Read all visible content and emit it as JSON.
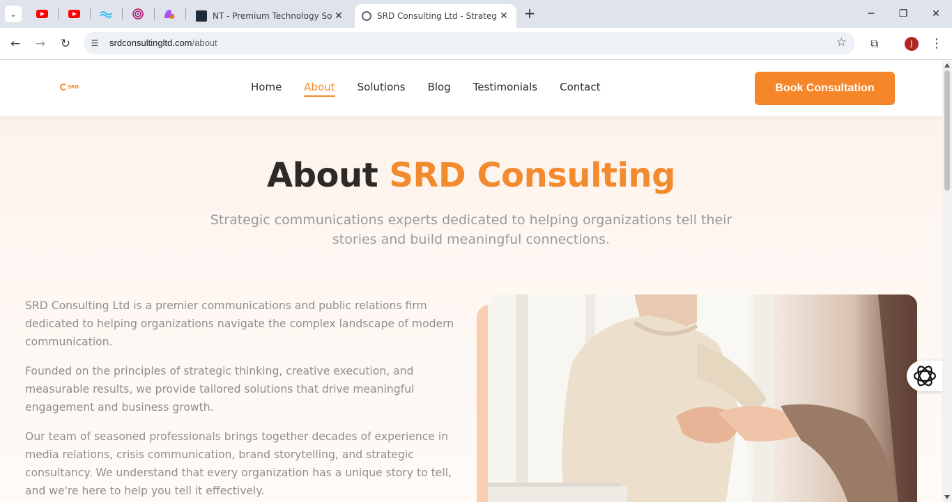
{
  "browser": {
    "tabs": [
      {
        "title": "NT - Premium Technology Solut",
        "active": false
      },
      {
        "title": "SRD Consulting Ltd - Strategic C",
        "active": true
      }
    ],
    "url_domain": "srdconsultingltd.com",
    "url_path": "/about",
    "profile_initial": "J"
  },
  "site": {
    "logo_text": "SRD",
    "nav": [
      "Home",
      "About",
      "Solutions",
      "Blog",
      "Testimonials",
      "Contact"
    ],
    "active_nav": "About",
    "cta_label": "Book Consultation",
    "accent_color": "#f28a2e"
  },
  "hero": {
    "title_plain": "About ",
    "title_accent": "SRD Consulting",
    "subtitle": "Strategic communications experts dedicated to helping organizations tell their stories and build meaningful connections."
  },
  "content": {
    "paragraphs": [
      "SRD Consulting Ltd is a premier communications and public relations firm dedicated to helping organizations navigate the complex landscape of modern communication.",
      "Founded on the principles of strategic thinking, creative execution, and measurable results, we provide tailored solutions that drive meaningful engagement and business growth.",
      "Our team of seasoned professionals brings together decades of experience in media relations, crisis communication, brand storytelling, and strategic consultancy. We understand that every organization has a unique story to tell, and we're here to help you tell it effectively."
    ]
  }
}
